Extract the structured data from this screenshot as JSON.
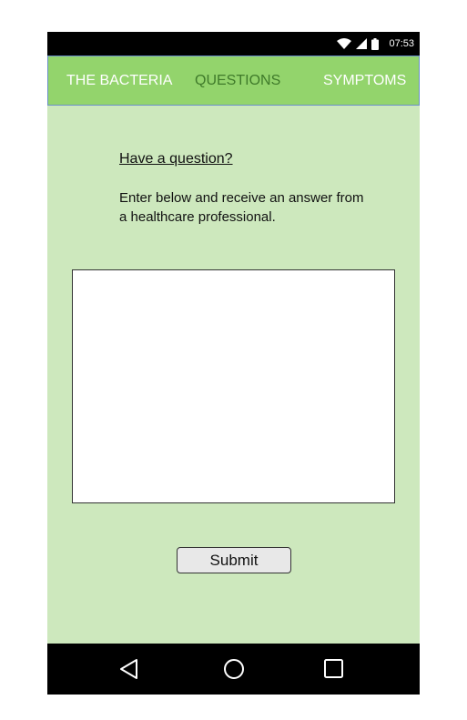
{
  "status_bar": {
    "time": "07:53",
    "icons": [
      "wifi-icon",
      "cellular-signal-icon",
      "battery-icon"
    ]
  },
  "tabs": [
    {
      "label": "THE BACTERIA",
      "active": false
    },
    {
      "label": "QUESTIONS",
      "active": true
    },
    {
      "label": "SYMPTOMS",
      "active": false
    }
  ],
  "content": {
    "heading": "Have a question?",
    "instructions": "Enter below and receive an answer from a healthcare professional.",
    "question_input": {
      "value": "",
      "placeholder": ""
    },
    "submit_label": "Submit"
  },
  "nav_bar": {
    "icons": [
      "back-icon",
      "home-icon",
      "recent-apps-icon"
    ]
  },
  "colors": {
    "background": "#cde8bd",
    "tab_bar": "#93d46c",
    "active_tab_text": "#3f7a2a",
    "inactive_tab_text": "#ffffff",
    "system_bars": "#000000"
  }
}
